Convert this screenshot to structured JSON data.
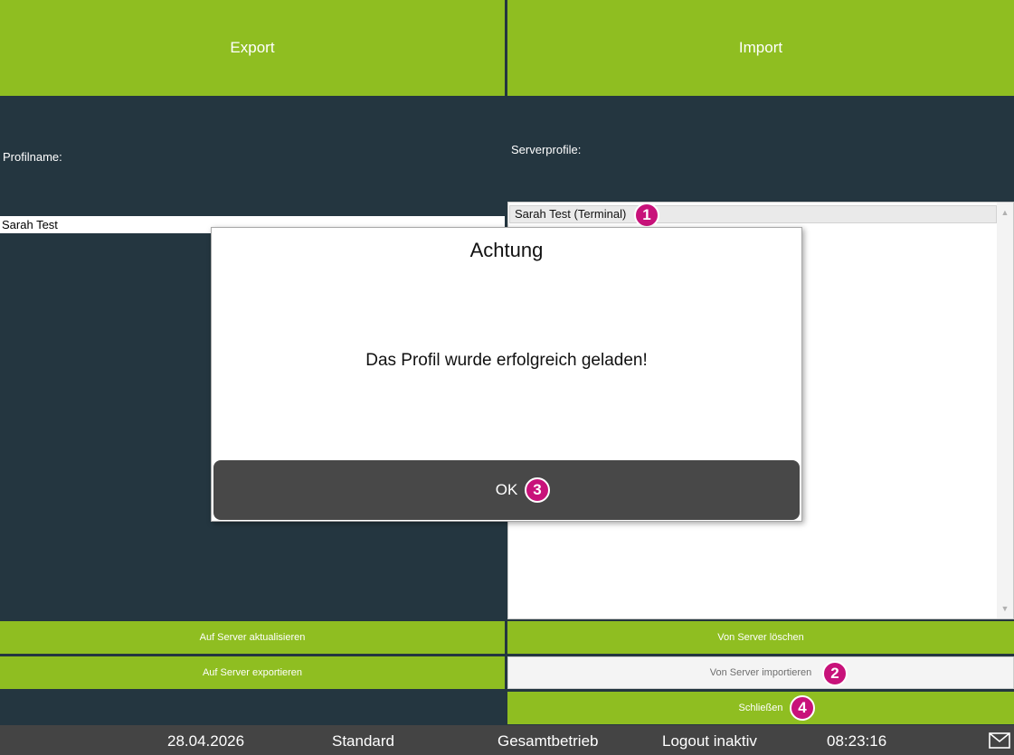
{
  "tabs": {
    "export": "Export",
    "import": "Import"
  },
  "export_panel": {
    "profile_label": "Profilname:",
    "profile_value": "Sarah Test"
  },
  "import_panel": {
    "server_label": "Serverprofile:",
    "profiles": [
      "Sarah Test (Terminal)"
    ]
  },
  "buttons": {
    "update": "Auf Server aktualisieren",
    "delete": "Von Server löschen",
    "export": "Auf Server exportieren",
    "import": "Von Server importieren",
    "close": "Schließen"
  },
  "dialog": {
    "title": "Achtung",
    "message": "Das Profil wurde erfolgreich geladen!",
    "ok_label": "OK"
  },
  "badges": {
    "b1": "1",
    "b2": "2",
    "b3": "3",
    "b4": "4"
  },
  "statusbar": {
    "date": "28.04.2026",
    "mode": "Standard",
    "operation": "Gesamtbetrieb",
    "logout": "Logout inaktiv",
    "time": "08:23:16"
  },
  "icons": {
    "mail": "mail-icon",
    "scroll_up": "chevron-up-icon",
    "scroll_down": "chevron-down-icon"
  },
  "colors": {
    "accent": "#8fbe21",
    "background": "#243640",
    "badge": "#c8127a",
    "statusbar": "#444444"
  }
}
